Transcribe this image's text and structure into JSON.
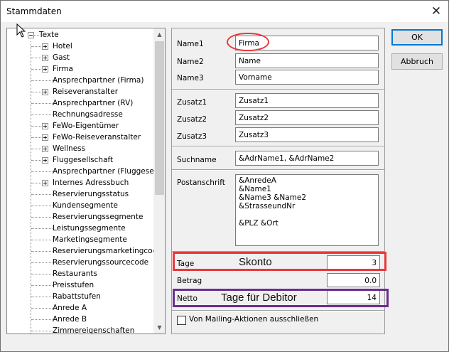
{
  "window": {
    "title": "Stammdaten",
    "close_glyph": "✕"
  },
  "tree": {
    "root": "Texte",
    "items": [
      {
        "label": "Hotel",
        "expandable": true
      },
      {
        "label": "Gast",
        "expandable": true
      },
      {
        "label": "Firma",
        "expandable": true
      },
      {
        "label": "Ansprechpartner (Firma)",
        "expandable": false
      },
      {
        "label": "Reiseveranstalter",
        "expandable": true
      },
      {
        "label": "Ansprechpartner (RV)",
        "expandable": false
      },
      {
        "label": "Rechnungsadresse",
        "expandable": false
      },
      {
        "label": "FeWo-Eigentümer",
        "expandable": true
      },
      {
        "label": "FeWo-Reiseveranstalter",
        "expandable": true
      },
      {
        "label": "Wellness",
        "expandable": true
      },
      {
        "label": "Fluggesellschaft",
        "expandable": true
      },
      {
        "label": "Ansprechpartner (Fluggesellsc",
        "expandable": false
      },
      {
        "label": "Internes Adressbuch",
        "expandable": true
      },
      {
        "label": "Reservierungsstatus",
        "expandable": false
      },
      {
        "label": "Kundensegmente",
        "expandable": false
      },
      {
        "label": "Reservierungssegmente",
        "expandable": false
      },
      {
        "label": "Leistungssegmente",
        "expandable": false
      },
      {
        "label": "Marketingsegmente",
        "expandable": false
      },
      {
        "label": "Reservierungsmarketingcode",
        "expandable": false
      },
      {
        "label": "Reservierungssourcecode",
        "expandable": false
      },
      {
        "label": "Restaurants",
        "expandable": false
      },
      {
        "label": "Preisstufen",
        "expandable": false
      },
      {
        "label": "Rabattstufen",
        "expandable": false
      },
      {
        "label": "Anrede A",
        "expandable": false
      },
      {
        "label": "Anrede B",
        "expandable": false
      },
      {
        "label": "Zimmereigenschaften",
        "expandable": false
      }
    ]
  },
  "form": {
    "name1": {
      "label": "Name1",
      "value": "Firma"
    },
    "name2": {
      "label": "Name2",
      "value": "Name"
    },
    "name3": {
      "label": "Name3",
      "value": "Vorname"
    },
    "zusatz1": {
      "label": "Zusatz1",
      "value": "Zusatz1"
    },
    "zusatz2": {
      "label": "Zusatz2",
      "value": "Zusatz2"
    },
    "zusatz3": {
      "label": "Zusatz3",
      "value": "Zusatz3"
    },
    "suchname": {
      "label": "Suchname",
      "value": "&AdrName1, &AdrName2"
    },
    "postanschrift": {
      "label": "Postanschrift",
      "value": "&AnredeA\n&Name1\n&Name3 &Name2\n&StrasseundNr\n\n&PLZ &Ort"
    },
    "tage": {
      "label": "Tage",
      "value": "3"
    },
    "betrag": {
      "label": "Betrag",
      "value": "0.0"
    },
    "netto": {
      "label": "Netto",
      "value": "14"
    },
    "mailing": {
      "label": "Von Mailing-Aktionen ausschließen",
      "checked": false
    }
  },
  "buttons": {
    "ok": "OK",
    "abbruch": "Abbruch"
  },
  "annotations": {
    "skonto": "Skonto",
    "tage_debitor": "Tage für Debitor",
    "colors": {
      "red": "#e8383d",
      "purple": "#6b2d8f"
    }
  },
  "colors": {
    "dialog_bg": "#f0f0f0",
    "focus_blue": "#0078d7"
  }
}
